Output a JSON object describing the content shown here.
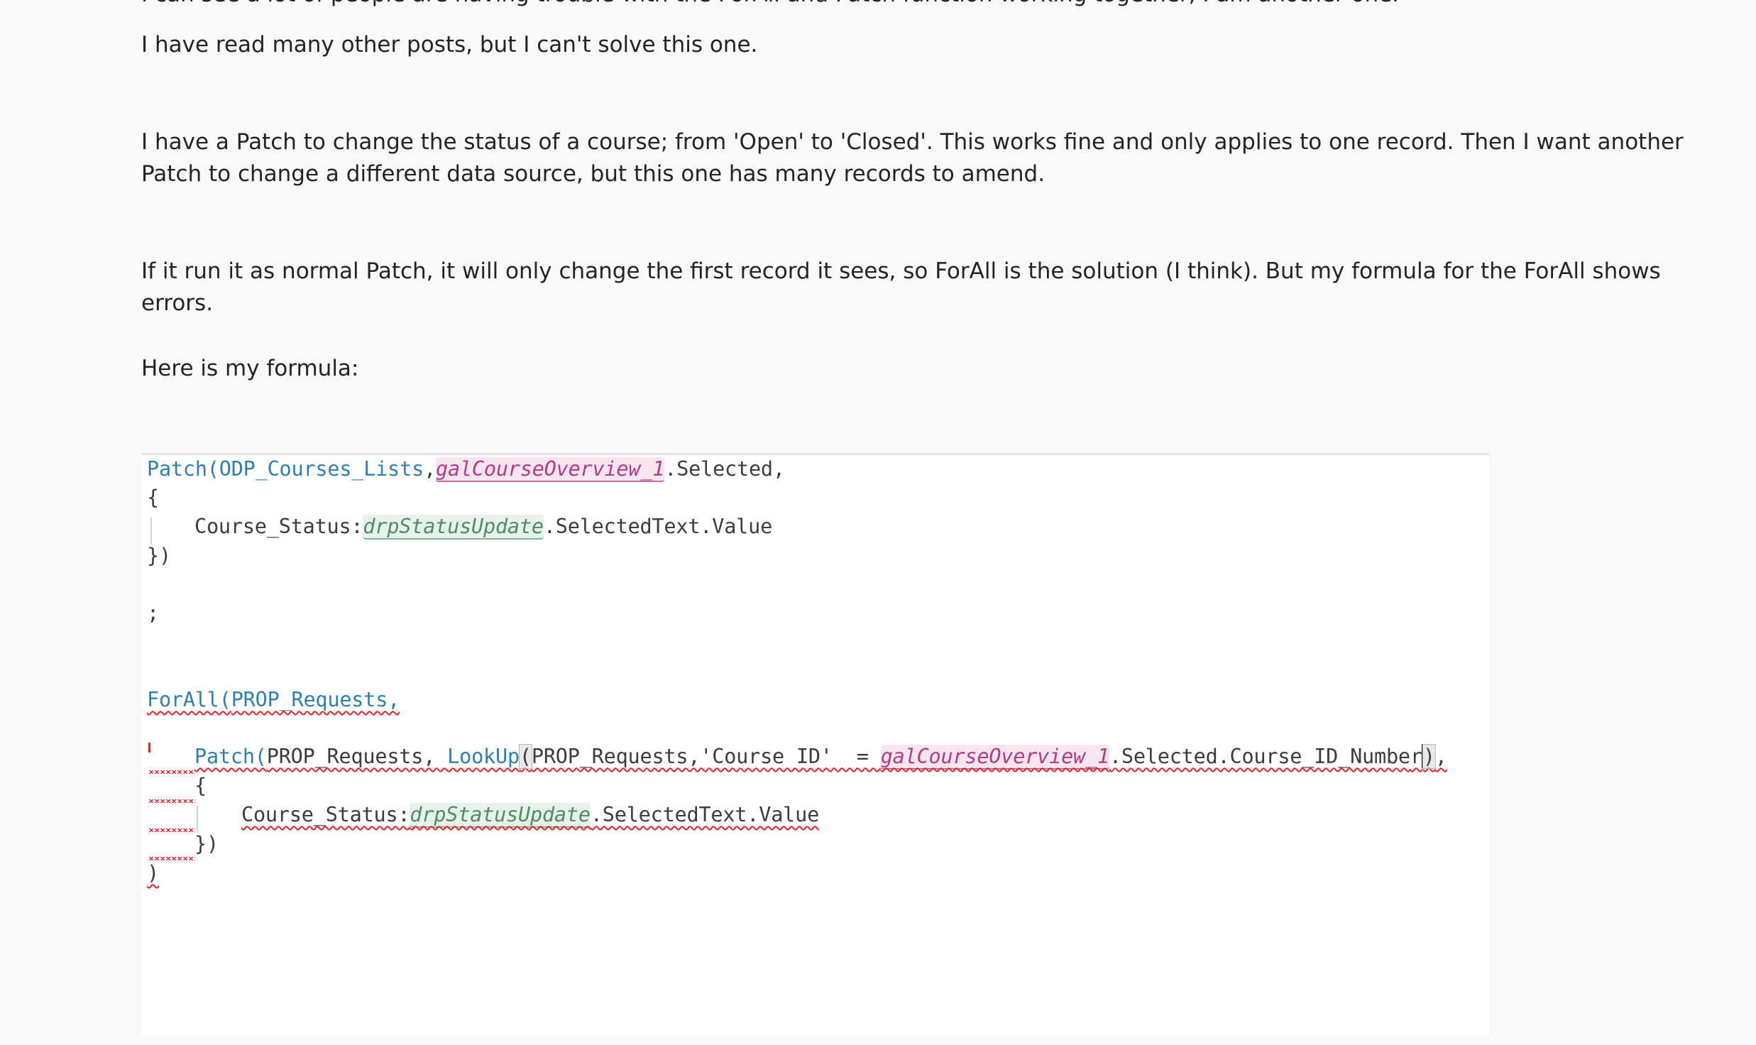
{
  "post": {
    "paragraphs": [
      "I can see a lot of people are having trouble with the ForAll and Patch function working together, I am another one.",
      "I have read many other posts, but I can't solve this one.",
      "I have a Patch to change the status of a course; from 'Open' to 'Closed'. This works fine and only applies to one record. Then I want another Patch to change a different data source, but this one has many records to amend.",
      "If it run it as normal Patch, it will only change the first record it sees, so ForAll is the solution (I think). But my formula for the ForAll shows errors.",
      "Here is my formula:"
    ]
  },
  "code": {
    "patch_fn": "Patch(",
    "patch_source": "ODP_Courses_Lists",
    "comma": ",",
    "gallery_control": "galCourseOverview_1",
    "selected_suffix": ".Selected,",
    "open_brace": "{",
    "field_course_status": "Course_Status:",
    "dropdown_control": "drpStatusUpdate",
    "selected_text_suffix": ".SelectedText.Value",
    "close_brace_paren": "})",
    "semicolon": ";",
    "forall_fn": "ForAll(",
    "forall_source": "PROP_Requests,",
    "inner_patch_fn": "Patch(",
    "inner_patch_source": "PROP_Requests, ",
    "lookup_fn": "LookUp",
    "lookup_open": "(",
    "lookup_args": "PROP_Requests,'Course ID'  = ",
    "lookup_suffix_a": ".Selected.Course_ID_Numbe",
    "lookup_suffix_b": "r",
    "lookup_close": ")",
    "trailing_comma": ",",
    "inner_open_brace": "{",
    "inner_field": "Course_Status:",
    "inner_dropdown_control": "drpStatusUpdate",
    "inner_selected_text_suffix": ".SelectedText.Value",
    "inner_close": "})",
    "outer_close": ")"
  },
  "colors": {
    "function": "#2f7fae",
    "control_pink": "#b43a86",
    "control_green": "#4f8d67",
    "error": "#e0242b",
    "text": "#242424"
  }
}
